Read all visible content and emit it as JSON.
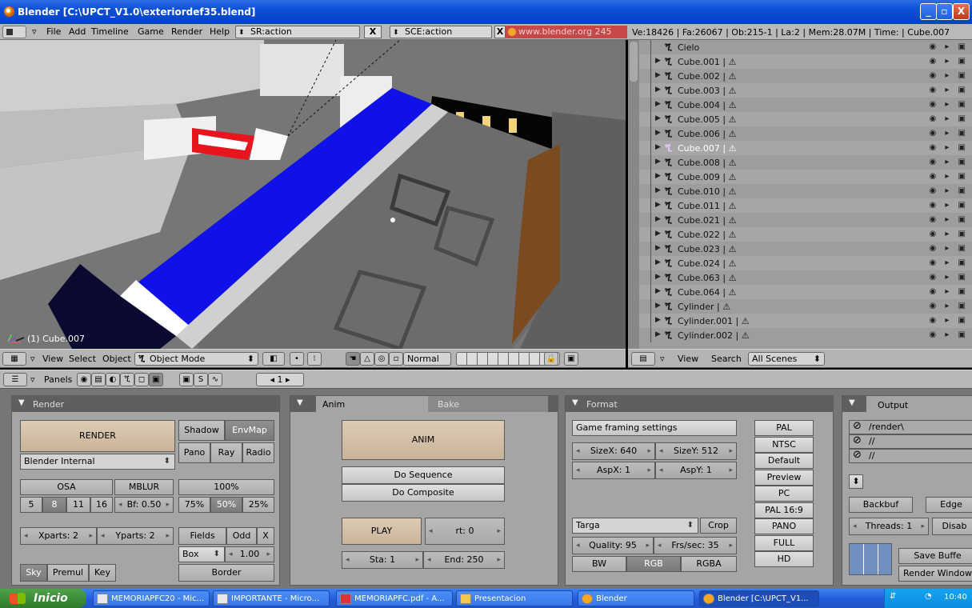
{
  "window": {
    "title": "Blender [C:\\UPCT_V1.0\\exteriordef35.blend]",
    "min": "_",
    "max": "▫",
    "close": "X"
  },
  "info_header": {
    "menus": [
      "File",
      "Add",
      "Timeline",
      "Game",
      "Render",
      "Help"
    ],
    "screen": "SR:action",
    "scene": "SCE:action",
    "x": "X",
    "link": "www.blender.org 245",
    "stats": "Ve:18426 | Fa:26067 | Ob:215-1 | La:2  | Mem:28.07M  | Time: | Cube.007"
  },
  "viewport": {
    "object_label": "(1) Cube.007"
  },
  "view3d_header": {
    "view": "View",
    "select": "Select",
    "object": "Object",
    "mode": "Object Mode",
    "pivot": "Normal"
  },
  "outliner": {
    "rows": [
      {
        "name": "Cielo",
        "sel": false,
        "restrict": "◉ ▸ ▣"
      },
      {
        "name": "Cube.001 | ⚠",
        "sel": false,
        "restrict": "◉ ▸ ▣"
      },
      {
        "name": "Cube.002 | ⚠",
        "sel": false,
        "restrict": "◉ ▸ ▣"
      },
      {
        "name": "Cube.003 | ⚠",
        "sel": false,
        "restrict": "◉ ▸ ▣"
      },
      {
        "name": "Cube.004 | ⚠",
        "sel": false,
        "restrict": "◉ ▸ ▣"
      },
      {
        "name": "Cube.005 | ⚠",
        "sel": false,
        "restrict": "◉ ▸ ▣"
      },
      {
        "name": "Cube.006 | ⚠",
        "sel": false,
        "restrict": "◉ ▸ ▣"
      },
      {
        "name": "Cube.007 | ⚠",
        "sel": true,
        "restrict": "◉ ▸ ▣"
      },
      {
        "name": "Cube.008 | ⚠",
        "sel": false,
        "restrict": "◉ ▸ ▣"
      },
      {
        "name": "Cube.009 | ⚠",
        "sel": false,
        "restrict": "◉ ▸ ▣"
      },
      {
        "name": "Cube.010 | ⚠",
        "sel": false,
        "restrict": "◉ ▸ ▣"
      },
      {
        "name": "Cube.011 | ⚠",
        "sel": false,
        "restrict": "◉ ▸ ▣"
      },
      {
        "name": "Cube.021 | ⚠",
        "sel": false,
        "restrict": "◉ ▸ ▣"
      },
      {
        "name": "Cube.022 | ⚠",
        "sel": false,
        "restrict": "◉ ▸ ▣"
      },
      {
        "name": "Cube.023 | ⚠",
        "sel": false,
        "restrict": "◉ ▸ ▣"
      },
      {
        "name": "Cube.024 | ⚠",
        "sel": false,
        "restrict": "◉ ▸ ▣"
      },
      {
        "name": "Cube.063 | ⚠",
        "sel": false,
        "restrict": "◉ ▸ ▣"
      },
      {
        "name": "Cube.064 | ⚠",
        "sel": false,
        "restrict": "◉ ▸ ▣"
      },
      {
        "name": "Cylinder | ⚠",
        "sel": false,
        "restrict": "◉ ▸ ▣"
      },
      {
        "name": "Cylinder.001 | ⚠",
        "sel": false,
        "restrict": "◉ ▸ ▣"
      },
      {
        "name": "Cylinder.002 | ⚠",
        "sel": false,
        "restrict": "◉ ▸ ▣"
      }
    ]
  },
  "outliner_header": {
    "view": "View",
    "search": "Search",
    "scenes": "All Scenes"
  },
  "buttons_header": {
    "panels": "Panels",
    "frame": "1"
  },
  "render_panel": {
    "title": "Render",
    "render": "RENDER",
    "shadow": "Shadow",
    "envmap": "EnvMap",
    "pano": "Pano",
    "ray": "Ray",
    "radio": "Radio",
    "engine": "Blender Internal",
    "osa": "OSA",
    "mblur": "MBLUR",
    "pct100": "100%",
    "osa5": "5",
    "osa8": "8",
    "osa11": "11",
    "osa16": "16",
    "bf": "Bf: 0.50",
    "pct75": "75%",
    "pct50": "50%",
    "pct25": "25%",
    "xparts": "Xparts: 2",
    "yparts": "Yparts: 2",
    "fields": "Fields",
    "odd": "Odd",
    "x": "X",
    "box": "Box",
    "filter": "1.00",
    "border": "Border",
    "sky": "Sky",
    "premul": "Premul",
    "key": "Key"
  },
  "anim_panel": {
    "tab_anim": "Anim",
    "tab_bake": "Bake",
    "anim": "ANIM",
    "do_sequence": "Do Sequence",
    "do_composite": "Do Composite",
    "play": "PLAY",
    "rt": "rt: 0",
    "sta": "Sta: 1",
    "end": "End: 250"
  },
  "format_panel": {
    "title": "Format",
    "game_framing": "Game framing settings",
    "sizex": "SizeX: 640",
    "sizey": "SizeY: 512",
    "aspx": "AspX: 1",
    "aspy": "AspY: 1",
    "presets": [
      "PAL",
      "NTSC",
      "Default",
      "Preview",
      "PC",
      "PAL 16:9",
      "PANO",
      "FULL",
      "HD"
    ],
    "filetype": "Targa",
    "crop": "Crop",
    "quality": "Quality: 95",
    "fps": "Frs/sec: 35",
    "bw": "BW",
    "rgb": "RGB",
    "rgba": "RGBA"
  },
  "output_panel": {
    "title": "Output",
    "path1": "/render\\",
    "path2": "//",
    "path3": "//",
    "backbuf": "Backbuf",
    "edge": "Edge",
    "threads": "Threads: 1",
    "disable": "Disab",
    "save_buffers": "Save Buffe",
    "render_window": "Render Window"
  },
  "taskbar": {
    "start": "Inicio",
    "tasks": [
      "MEMORIAPFC20 - Mic...",
      "IMPORTANTE - Micro...",
      "MEMORIAPFC.pdf - A...",
      "Presentacion",
      "Blender",
      "Blender [C:\\UPCT_V1..."
    ],
    "clock": "10:40"
  }
}
